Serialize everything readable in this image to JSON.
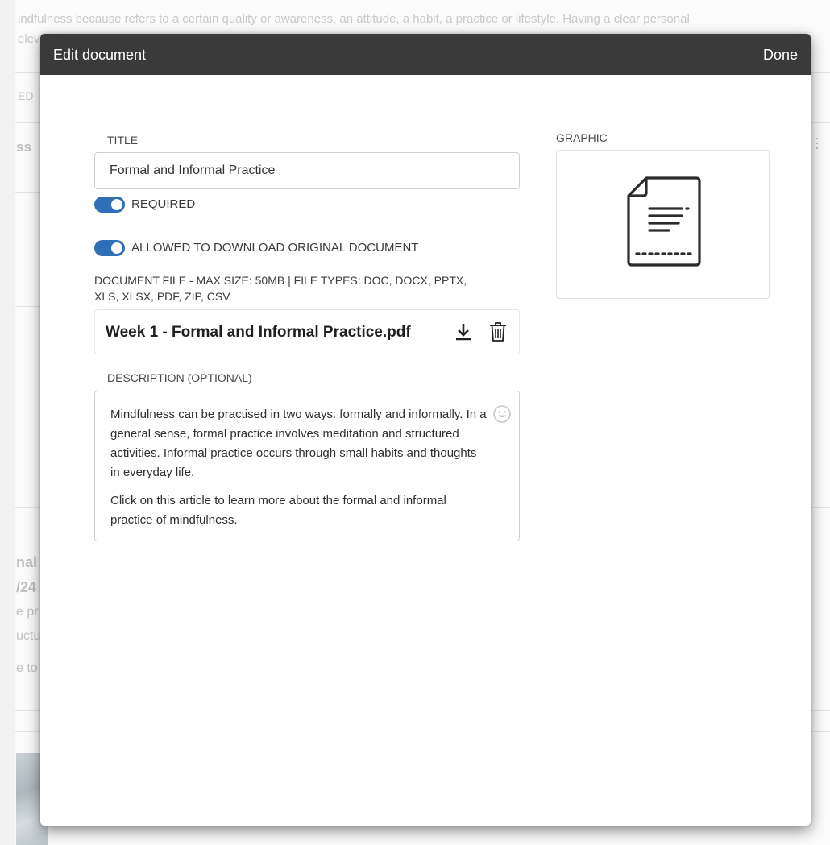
{
  "background": {
    "top_line_1": "indfulness because refers to a certain quality or awareness, an attitude, a habit, a practice or lifestyle. Having a clear personal",
    "top_line_2": "elev",
    "fragments": [
      "ED",
      "ss",
      "nal",
      "/24",
      "e pr",
      "uctu",
      "e to"
    ]
  },
  "modal": {
    "title": "Edit document",
    "done_label": "Done"
  },
  "form": {
    "title_label": "TITLE",
    "title_value": "Formal and Informal Practice",
    "required_label": "REQUIRED",
    "required_on": true,
    "download_label": "ALLOWED TO DOWNLOAD ORIGINAL DOCUMENT",
    "download_on": true,
    "file_note_line_1": "DOCUMENT FILE - MAX SIZE: 50MB | FILE TYPES: DOC, DOCX, PPTX,",
    "file_note_line_2": "XLS, XLSX, PDF, ZIP, CSV",
    "file_name": "Week 1 - Formal and Informal Practice.pdf",
    "download_icon": "download-icon",
    "delete_icon": "trash-icon",
    "description_label": "DESCRIPTION (OPTIONAL)",
    "description_paragraphs": [
      "Mindfulness can be practised in two ways: formally and informally. In a general sense, formal practice involves meditation and structured activities. Informal practice occurs through small habits and thoughts in everyday life.",
      "Click on this article to learn more about the formal and informal practice of mindfulness."
    ],
    "emoji_icon": "smiley-icon"
  },
  "graphic": {
    "label": "GRAPHIC",
    "icon": "document-icon"
  },
  "colors": {
    "header": "#3a3a3a",
    "toggle_on": "#2e6fb7"
  }
}
